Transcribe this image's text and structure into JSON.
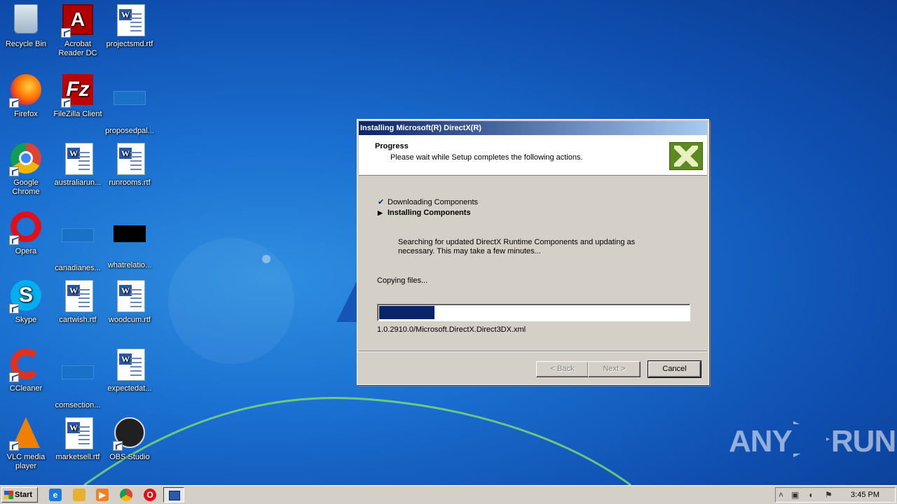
{
  "desktop": {
    "icons": [
      {
        "label": "Recycle Bin"
      },
      {
        "label": "Acrobat Reader DC"
      },
      {
        "label": "projectsmd.rtf"
      },
      {
        "label": "Firefox"
      },
      {
        "label": "FileZilla Client"
      },
      {
        "label": "proposedpal..."
      },
      {
        "label": "Google Chrome"
      },
      {
        "label": "australiarun..."
      },
      {
        "label": "runrooms.rtf"
      },
      {
        "label": "Opera"
      },
      {
        "label": "canadianes..."
      },
      {
        "label": "whatrelatio..."
      },
      {
        "label": "Skype"
      },
      {
        "label": "cartwish.rtf"
      },
      {
        "label": "woodcum.rtf"
      },
      {
        "label": "CCleaner"
      },
      {
        "label": "comsection..."
      },
      {
        "label": "expectedat..."
      },
      {
        "label": "VLC media player"
      },
      {
        "label": "marketsell.rtf"
      },
      {
        "label": "OBS Studio"
      }
    ]
  },
  "dialog": {
    "title": "Installing Microsoft(R) DirectX(R)",
    "header_title": "Progress",
    "header_subtitle": "Please wait while Setup completes the following actions.",
    "steps": [
      {
        "label": "Downloading Components",
        "status": "done",
        "marker": "✔"
      },
      {
        "label": "Installing Components",
        "status": "current",
        "marker": "▶"
      }
    ],
    "description": "Searching for updated DirectX Runtime Components and updating as necessary. This may take a few minutes...",
    "status_text": "Copying files...",
    "progress_fraction": 0.18,
    "current_file": "1.0.2910.0/Microsoft.DirectX.Direct3DX.xml",
    "buttons": {
      "back": "< Back",
      "next": "Next >",
      "cancel": "Cancel"
    }
  },
  "taskbar": {
    "start_label": "Start",
    "clock": "3:45 PM"
  },
  "watermark": {
    "left": "ANY",
    "right": "RUN"
  },
  "colors": {
    "titlebar": "#0a246a",
    "progress": "#0a246a",
    "desktop": "#1a6fd0"
  }
}
